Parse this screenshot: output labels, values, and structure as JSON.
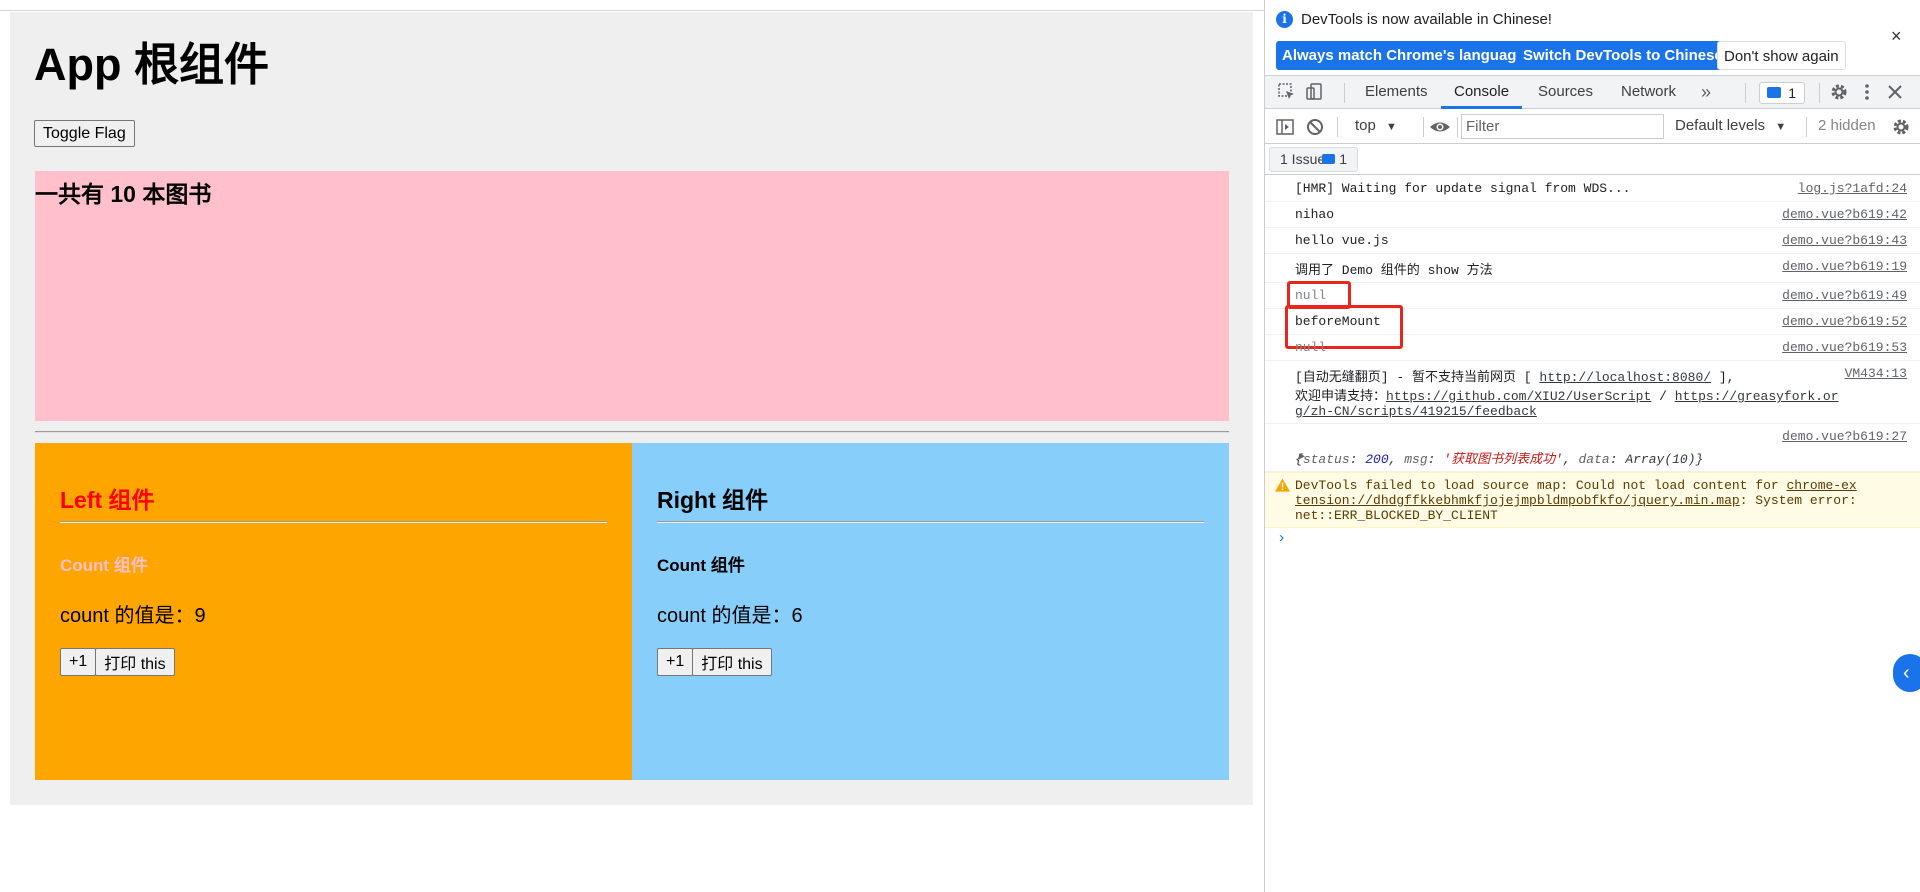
{
  "app": {
    "title": "App 根组件",
    "toggle_label": "Toggle Flag",
    "books_text": "一共有 10 本图书",
    "left": {
      "title": "Left 组件",
      "count_title": "Count 组件",
      "count_text": "count 的值是：9",
      "plus_label": "+1",
      "print_label": "打印 this"
    },
    "right": {
      "title": "Right 组件",
      "count_title": "Count 组件",
      "count_text": "count 的值是：6",
      "plus_label": "+1",
      "print_label": "打印 this"
    },
    "colors": {
      "books_bg": "#ffc0cb",
      "left_bg": "#ffa500",
      "right_bg": "#87cefa",
      "left_title": "#ff0000",
      "left_count_title": "#ffc0cb"
    }
  },
  "devtools": {
    "infobar": {
      "text": "DevTools is now available in Chinese!",
      "match_label": "Always match Chrome's language",
      "switch_label": "Switch DevTools to Chinese",
      "dont_label": "Don't show again",
      "close_glyph": "×"
    },
    "tabs": [
      "Elements",
      "Console",
      "Sources",
      "Network"
    ],
    "active_tab": "Console",
    "more_tabs_glyph": "»",
    "issues_badge_count": "1",
    "toolbar": {
      "context": "top",
      "filter_placeholder": "Filter",
      "levels": "Default levels",
      "hidden": "2 hidden"
    },
    "issues_button": {
      "label": "1 Issue:",
      "count": "1"
    },
    "logs": [
      {
        "msg": "[HMR] Waiting for update signal from WDS...",
        "src": "log.js?1afd:24"
      },
      {
        "msg": "nihao",
        "src": "demo.vue?b619:42"
      },
      {
        "msg": "hello vue.js",
        "src": "demo.vue?b619:43"
      },
      {
        "msg": "调用了 Demo 组件的 show 方法",
        "src": "demo.vue?b619:19"
      },
      {
        "msg": "null",
        "src": "demo.vue?b619:49"
      },
      {
        "msg": "beforeMount",
        "src": "demo.vue?b619:52"
      },
      {
        "msg": "null",
        "src": "demo.vue?b619:53"
      },
      {
        "msg_prefix": "[自动无缝翻页] - 暂不支持当前网页 [",
        "msg_link1": "http://localhost:8080/",
        "msg_suffix": "],",
        "msg_line2": "欢迎申请支持：",
        "msg_link2": "https://github.com/XIU2/UserScript",
        "msg_sep": "/",
        "msg_link3a": "https://greasyfork.or",
        "msg_link3b": "g/zh-CN/scripts/419215/feedback",
        "src": "VM434:13"
      },
      {
        "src": "demo.vue?b619:27",
        "obj_open": "{",
        "obj_k1": "status",
        "obj_v1": "200",
        "obj_k2": "msg",
        "obj_v2": "'获取图书列表成功'",
        "obj_k3": "data",
        "obj_v3": "Array(10)",
        "obj_close": "}"
      },
      {
        "warn_prefix": "DevTools failed to load source map: Could not load content for",
        "warn_link_a": "chrome-ex",
        "warn_link_b": "tension://dhdgffkkebhmkfjojejmpbldmpobfkfo/jquery.min.map",
        "warn_suffix": ": System error:",
        "warn_line3": "net::ERR_BLOCKED_BY_CLIENT"
      }
    ],
    "prompt_glyph": "›",
    "sidebar_toggle_glyph": "‹",
    "colors": {
      "accent": "#1a73e8",
      "annotation_red": "#e8261e",
      "warning_bg": "#fffbe5"
    }
  }
}
